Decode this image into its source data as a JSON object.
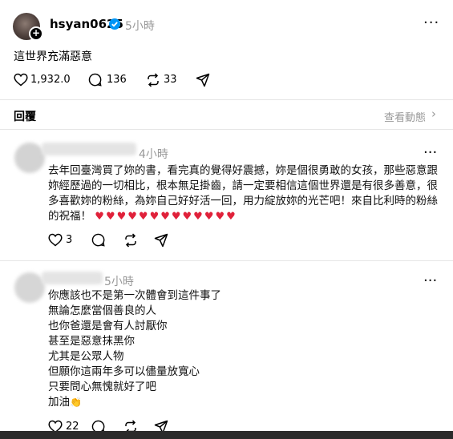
{
  "post": {
    "username": "hsyan0625",
    "time": "5小時",
    "text": "這世界充滿惡意",
    "likes": "1,932.0",
    "comments": "136",
    "reposts": "33"
  },
  "replies_bar": {
    "label": "回覆",
    "activity": "查看動態"
  },
  "comment1": {
    "time": "4小時",
    "text": "去年回臺灣買了妳的書，看完真的覺得好震撼，妳是個很勇敢的女孩，那些惡意跟妳經歷過的一切相比，根本無足掛齒，請一定要相信這個世界還是有很多善意，很多喜歡妳的粉絲，為妳自己好好活一回，用力綻放妳的光芒吧！來自比利時的粉絲的祝福！",
    "hearts": "♥♥♥♥♥♥♥♥♥♥♥♥♥",
    "likes": "3"
  },
  "comment2": {
    "time": "5小時",
    "lines": [
      "你應該也不是第一次體會到這件事了",
      "無論怎麼當個善良的人",
      "也你爸還是會有人討厭你",
      "甚至是惡意抹黑你",
      "尤其是公眾人物",
      "但願你這兩年多可以儘量放寬心",
      "只要問心無愧就好了吧",
      "加油"
    ],
    "clap": "👏",
    "likes": "22"
  },
  "colors": {
    "verified": "#0095f6",
    "heart": "#e0213a",
    "divider": "#e6e6e6"
  }
}
